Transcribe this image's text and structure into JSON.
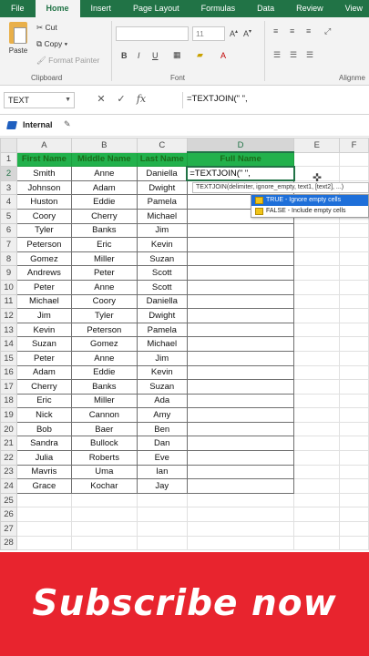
{
  "ribbon": {
    "tabs": [
      "File",
      "Home",
      "Insert",
      "Page Layout",
      "Formulas",
      "Data",
      "Review",
      "View"
    ],
    "active_tab": "Home",
    "clipboard": {
      "paste_label": "Paste",
      "cut_label": "Cut",
      "copy_label": "Copy",
      "format_painter_label": "Format Painter",
      "group_label": "Clipboard"
    },
    "font": {
      "size_value": "11",
      "group_label": "Font"
    },
    "alignment": {
      "group_label": "Alignme"
    }
  },
  "formula_bar": {
    "name_box": "TEXT",
    "cancel_icon": "close-icon",
    "enter_icon": "check-icon",
    "fx_label": "fx",
    "formula": "=TEXTJOIN(\" \","
  },
  "sensitivity": {
    "label": "Internal"
  },
  "sheet": {
    "columns": [
      "A",
      "B",
      "C",
      "D",
      "E",
      "F"
    ],
    "active_column": "D",
    "active_row": 2,
    "header": [
      "First Name",
      "Middle Name",
      "Last Name",
      "Full Name"
    ],
    "rows": [
      [
        "Smith",
        "Anne",
        "Daniella"
      ],
      [
        "Johnson",
        "Adam",
        "Dwight"
      ],
      [
        "Huston",
        "Eddie",
        "Pamela"
      ],
      [
        "Coory",
        "Cherry",
        "Michael"
      ],
      [
        "Tyler",
        "Banks",
        "Jim"
      ],
      [
        "Peterson",
        "Eric",
        "Kevin"
      ],
      [
        "Gomez",
        "Miller",
        "Suzan"
      ],
      [
        "Andrews",
        "Peter",
        "Scott"
      ],
      [
        "Peter",
        "Anne",
        "Scott"
      ],
      [
        "Michael",
        "Coory",
        "Daniella"
      ],
      [
        "Jim",
        "Tyler",
        "Dwight"
      ],
      [
        "Kevin",
        "Peterson",
        "Pamela"
      ],
      [
        "Suzan",
        "Gomez",
        "Michael"
      ],
      [
        "Peter",
        "Anne",
        "Jim"
      ],
      [
        "Adam",
        "Eddie",
        "Kevin"
      ],
      [
        "Cherry",
        "Banks",
        "Suzan"
      ],
      [
        "Eric",
        "Miller",
        "Ada"
      ],
      [
        "Nick",
        "Cannon",
        "Amy"
      ],
      [
        "Bob",
        "Baer",
        "Ben"
      ],
      [
        "Sandra",
        "Bullock",
        "Dan"
      ],
      [
        "Julia",
        "Roberts",
        "Eve"
      ],
      [
        "Mavris",
        "Uma",
        "Ian"
      ],
      [
        "Grace",
        "Kochar",
        "Jay"
      ]
    ],
    "editing_cell_text": "=TEXTJOIN(\" \",",
    "row_numbers": [
      "1",
      "2",
      "3",
      "4",
      "5",
      "6",
      "7",
      "8",
      "9",
      "10",
      "11",
      "12",
      "13",
      "14",
      "15",
      "16",
      "17",
      "18",
      "19",
      "20",
      "21",
      "22",
      "23",
      "24",
      "25",
      "26",
      "27",
      "28"
    ]
  },
  "autocomplete": {
    "tooltip": "TEXTJOIN(delimiter, ignore_empty, text1, [text2], ...)",
    "options": [
      "TRUE - Ignore empty cells",
      "FALSE - Include empty cells"
    ]
  },
  "banner": {
    "text": "Subscribe now"
  },
  "colors": {
    "excel_green": "#217346",
    "header_green": "#22b14c",
    "banner_red": "#e8242e",
    "selection_blue": "#1e6fd9"
  }
}
